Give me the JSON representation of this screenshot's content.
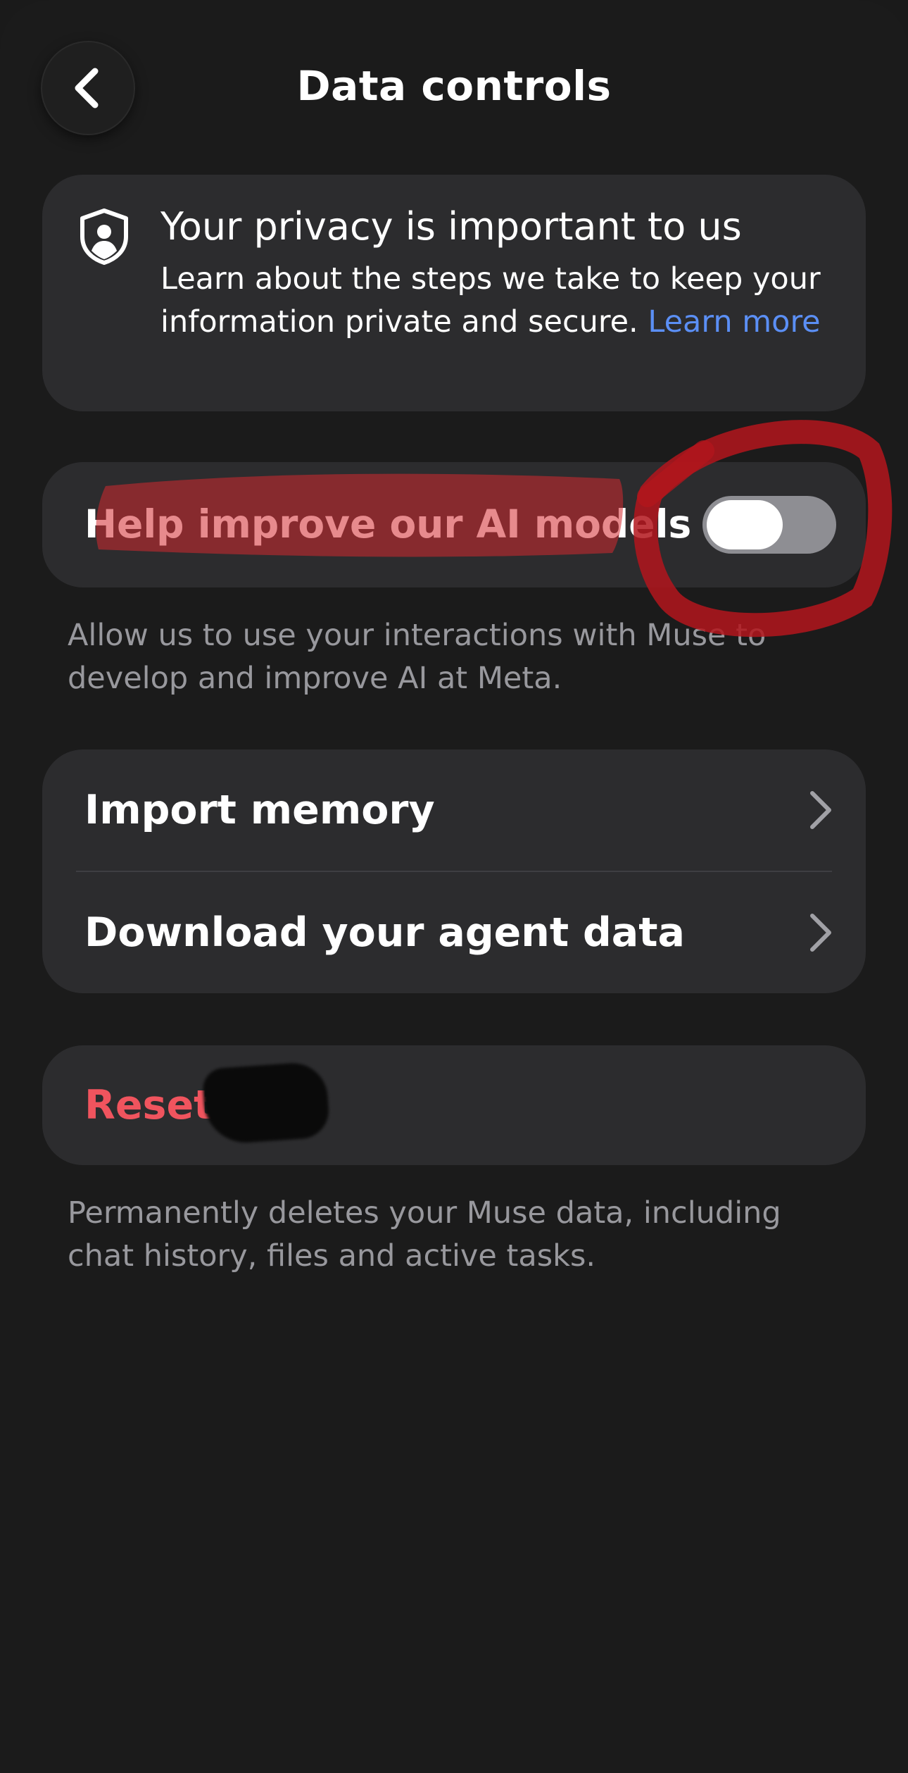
{
  "header": {
    "title": "Data controls"
  },
  "privacy_card": {
    "title": "Your privacy is important to us",
    "body": "Learn about the steps we take to keep your information private and secure.",
    "link": "Learn more"
  },
  "ai_toggle": {
    "label": "Help improve our AI models",
    "enabled": false,
    "helper": "Allow us to use your interactions with Muse to develop and improve AI at Meta."
  },
  "menu": {
    "items": [
      {
        "label": "Import memory"
      },
      {
        "label": "Download your agent data"
      }
    ]
  },
  "reset": {
    "label": "Reset",
    "helper": "Permanently deletes your Muse data, including chat history, files and active tasks."
  },
  "colors": {
    "background": "#1b1b1b",
    "card": "#2c2c2e",
    "link": "#5b8ff5",
    "destructive": "#f0545e",
    "secondary_text": "#98989d",
    "annotation_red": "#d42a2f"
  },
  "icons": {
    "back": "chevron-left-icon",
    "privacy": "shield-person-icon",
    "menu_row": "chevron-right-icon"
  }
}
